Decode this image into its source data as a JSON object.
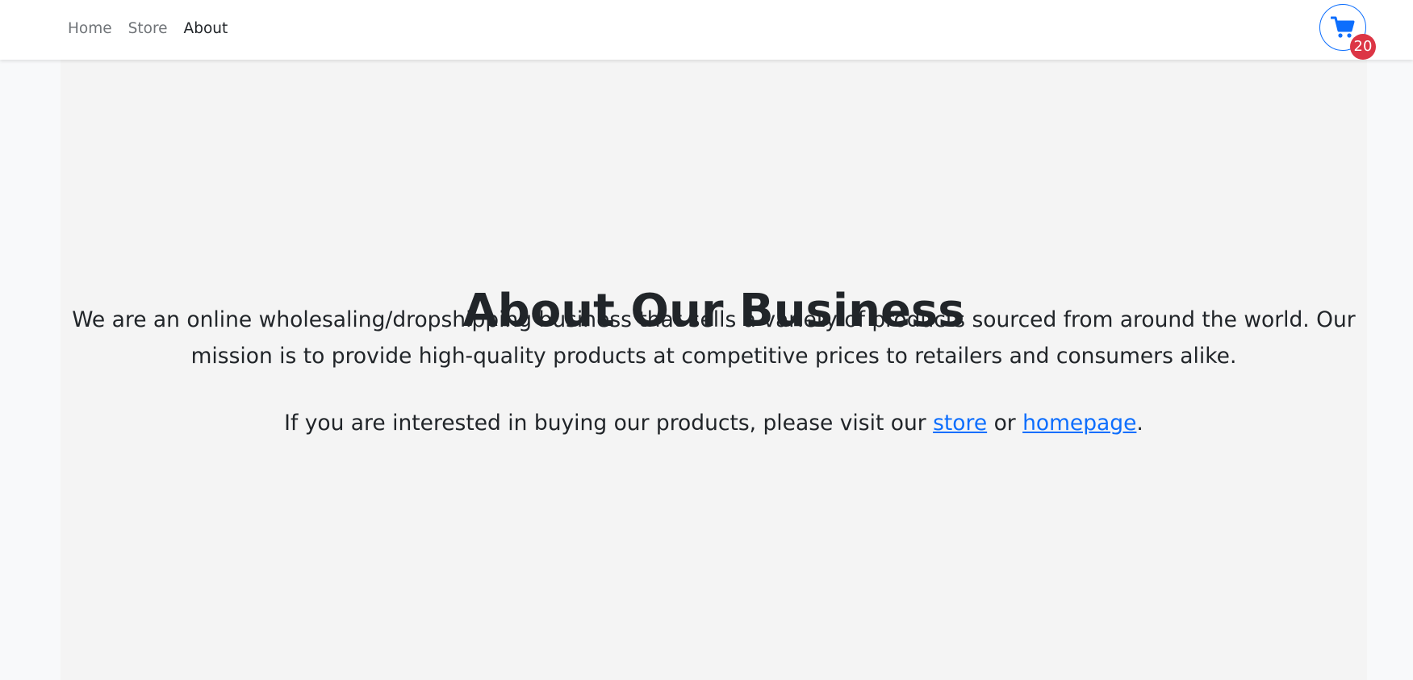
{
  "nav": {
    "links": [
      {
        "label": "Home"
      },
      {
        "label": "Store"
      },
      {
        "label": "About"
      }
    ],
    "active": "About"
  },
  "cart": {
    "icon": "shopping-cart-icon",
    "count": "20",
    "accent_color": "#0d6efd",
    "badge_color": "#dc3545"
  },
  "main": {
    "title": "About Our Business",
    "description": "We are an online wholesaling/dropshipping business that sells a variety of products sourced from around the world. Our mission is to provide high-quality products at competitive prices to retailers and consumers alike.",
    "visit_prefix": "If you are interested in buying our products, please visit our ",
    "store_link": "store",
    "or_text": " or ",
    "homepage_link": "homepage",
    "period": "."
  }
}
